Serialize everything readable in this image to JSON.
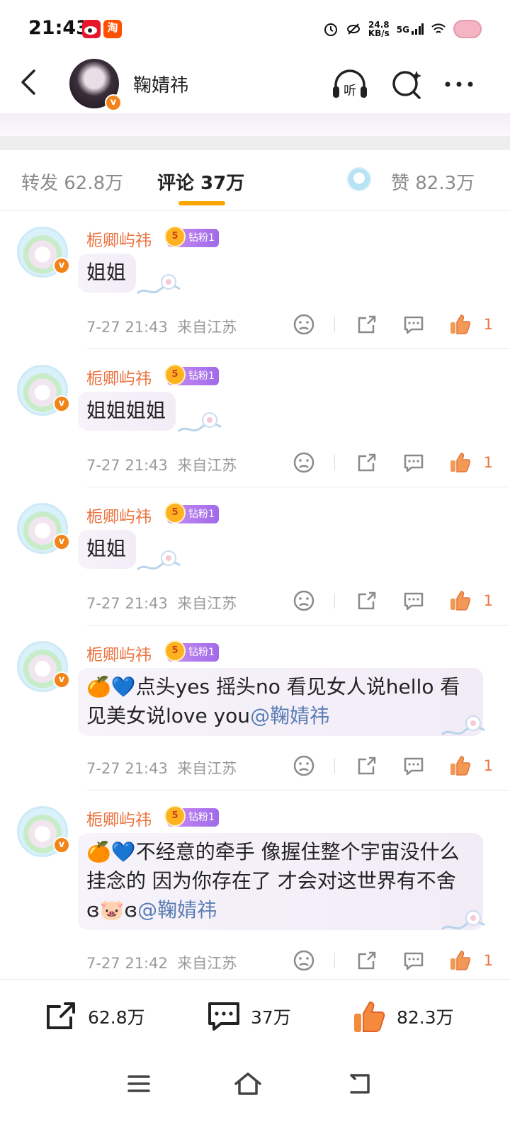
{
  "status_bar": {
    "time": "21:43",
    "net_speed_value": "24.8",
    "net_speed_unit": "KB/s",
    "network": "5G",
    "apps": [
      "weibo-icon",
      "taobao-icon"
    ],
    "taobao_char": "淘"
  },
  "header": {
    "name": "鞠婧祎",
    "verified_mark": "v",
    "icons": [
      "back-icon",
      "headphones-listen-icon",
      "search-sparkle-icon",
      "more-icon"
    ],
    "listen_char": "听"
  },
  "tabs": {
    "repost": "转发 62.8万",
    "comment": "评论 37万",
    "like": "赞 82.3万"
  },
  "comments": [
    {
      "user": "栀卿屿祎",
      "badge_level": "5",
      "badge_text": "钻粉1",
      "text": "姐姐",
      "mention": "",
      "time": "7-27 21:43",
      "location": "来自江苏",
      "likes": "1"
    },
    {
      "user": "栀卿屿祎",
      "badge_level": "5",
      "badge_text": "钻粉1",
      "text": "姐姐姐姐",
      "mention": "",
      "time": "7-27 21:43",
      "location": "来自江苏",
      "likes": "1"
    },
    {
      "user": "栀卿屿祎",
      "badge_level": "5",
      "badge_text": "钻粉1",
      "text": "姐姐",
      "mention": "",
      "time": "7-27 21:43",
      "location": "来自江苏",
      "likes": "1"
    },
    {
      "user": "栀卿屿祎",
      "badge_level": "5",
      "badge_text": "钻粉1",
      "text": "🍊💙点头yes  摇头no  看见女人说hello  看见美女说love you",
      "mention": "@鞠婧祎",
      "time": "7-27 21:43",
      "location": "来自江苏",
      "likes": "1"
    },
    {
      "user": "栀卿屿祎",
      "badge_level": "5",
      "badge_text": "钻粉1",
      "text": "🍊💙不经意的牵手  像握住整个宇宙没什么挂念的  因为你存在了  才会对这世界有不舍 ɞ🐷ɞ",
      "mention": "@鞠婧祎",
      "time": "7-27 21:42",
      "location": "来自江苏",
      "likes": "1"
    }
  ],
  "bottom_bar": {
    "repost_count": "62.8万",
    "comment_count": "37万",
    "like_count": "82.3万"
  },
  "nav": [
    "menu-icon",
    "home-icon",
    "back-nav-icon"
  ],
  "colors": {
    "accent_orange": "#eb7340",
    "tab_indicator": "#f7a600",
    "mention_blue": "#5a7db4",
    "badge_purple": "#a06be8"
  }
}
